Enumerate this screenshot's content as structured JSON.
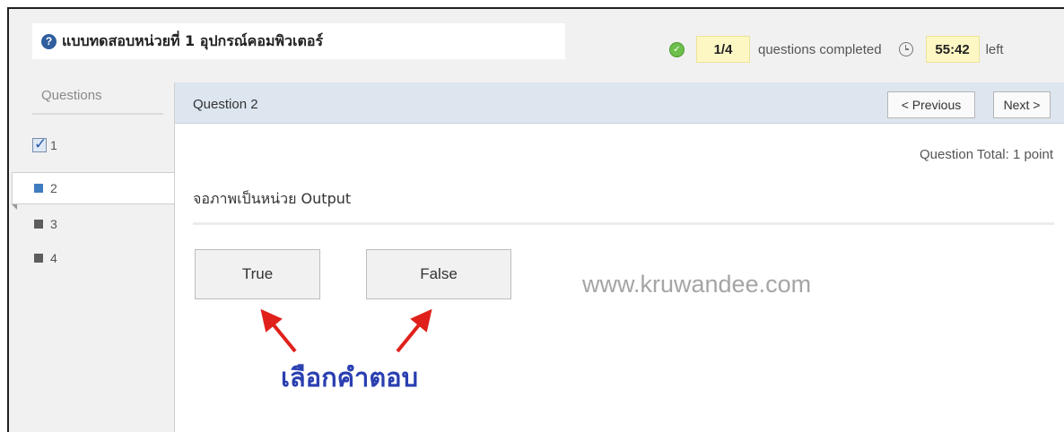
{
  "header": {
    "quiz_title": "แบบทดสอบหน่วยที่ 1 อุปกรณ์คอมพิวเตอร์",
    "progress": "1/4",
    "progress_text": "questions completed",
    "timer": "55:42",
    "timer_suffix": "left"
  },
  "sidebar": {
    "heading": "Questions",
    "items": [
      {
        "number": "1",
        "state": "answered"
      },
      {
        "number": "2",
        "state": "current"
      },
      {
        "number": "3",
        "state": "unanswered"
      },
      {
        "number": "4",
        "state": "unanswered"
      }
    ]
  },
  "question": {
    "label": "Question 2",
    "prev_label": "< Previous",
    "next_label": "Next >",
    "points": "Question Total: 1 point",
    "text": "จอภาพเป็นหน่วย Output",
    "answers": [
      "True",
      "False"
    ]
  },
  "overlay": {
    "watermark": "www.kruwandee.com",
    "annotation": "เลือกคำตอบ",
    "arrow_color": "#e0211b"
  },
  "icons": {
    "help": "question-circle-icon",
    "completed": "check-circle-icon",
    "timer": "clock-icon",
    "answered": "checkbox-checked-icon"
  },
  "colors": {
    "header_bar": "#dde6ef",
    "highlight": "#fdf7c4",
    "accent_blue": "#3f7cbf",
    "annotation_text": "#2a3fb0"
  }
}
